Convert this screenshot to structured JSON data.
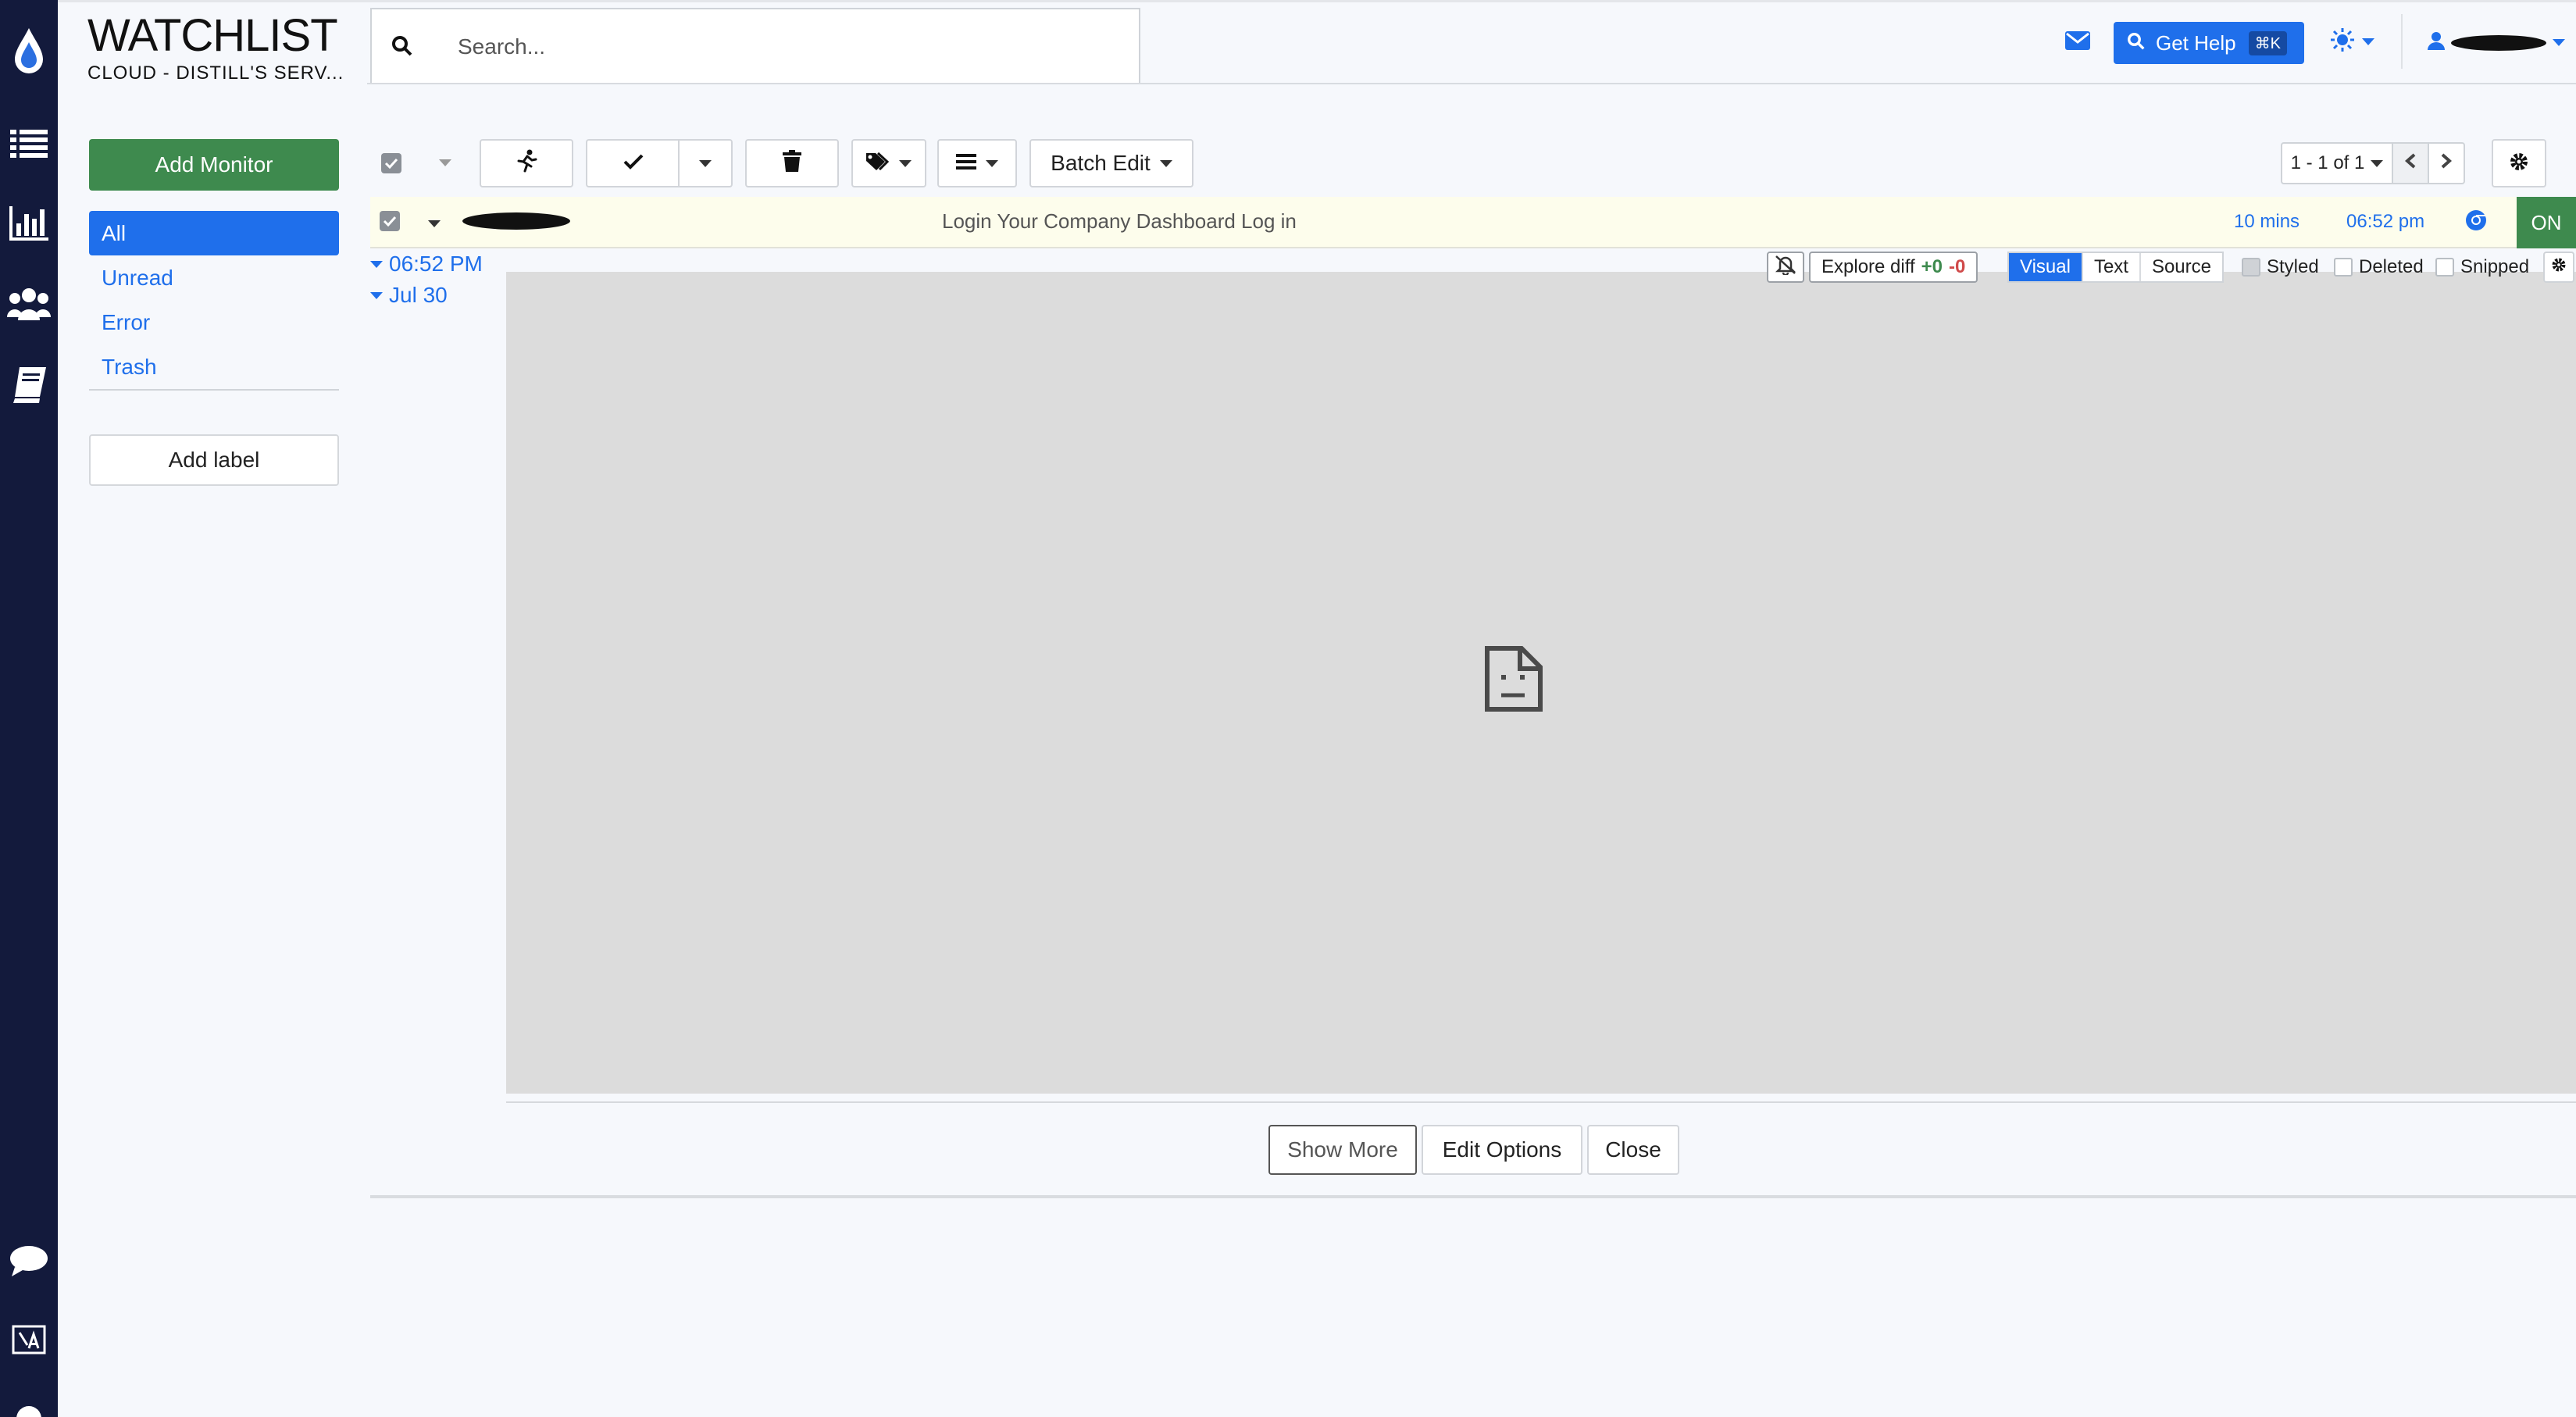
{
  "brand": {
    "title": "WATCHLIST",
    "subtitle": "CLOUD - DISTILL'S SERV..."
  },
  "search": {
    "placeholder": "Search..."
  },
  "header": {
    "get_help_label": "Get Help",
    "get_help_shortcut": "⌘K"
  },
  "sidebar": {
    "add_monitor_label": "Add Monitor",
    "items": [
      {
        "label": "All",
        "active": true
      },
      {
        "label": "Unread"
      },
      {
        "label": "Error"
      },
      {
        "label": "Trash"
      }
    ],
    "add_label_label": "Add label"
  },
  "toolbar": {
    "batch_edit_label": "Batch Edit",
    "pager_text": "1 - 1 of 1"
  },
  "monitor": {
    "title": "Login Your Company Dashboard Log in",
    "interval": "10 mins",
    "last_checked": "06:52 pm",
    "status": "ON"
  },
  "timeline": {
    "items": [
      "06:52 PM",
      "Jul 30"
    ]
  },
  "diff_toolbar": {
    "explore_label": "Explore diff",
    "added": "+0",
    "removed": "-0",
    "tabs": [
      "Visual",
      "Text",
      "Source"
    ],
    "active_tab": "Visual",
    "options": [
      {
        "label": "Styled",
        "checked": true
      },
      {
        "label": "Deleted",
        "checked": false
      },
      {
        "label": "Snipped",
        "checked": false
      }
    ]
  },
  "actions": {
    "show_more": "Show More",
    "edit_options": "Edit Options",
    "close": "Close"
  },
  "colors": {
    "rail": "#131a3c",
    "accent": "#1f6feb",
    "green": "#3e8a4e",
    "row_highlight": "#fdfdec"
  }
}
